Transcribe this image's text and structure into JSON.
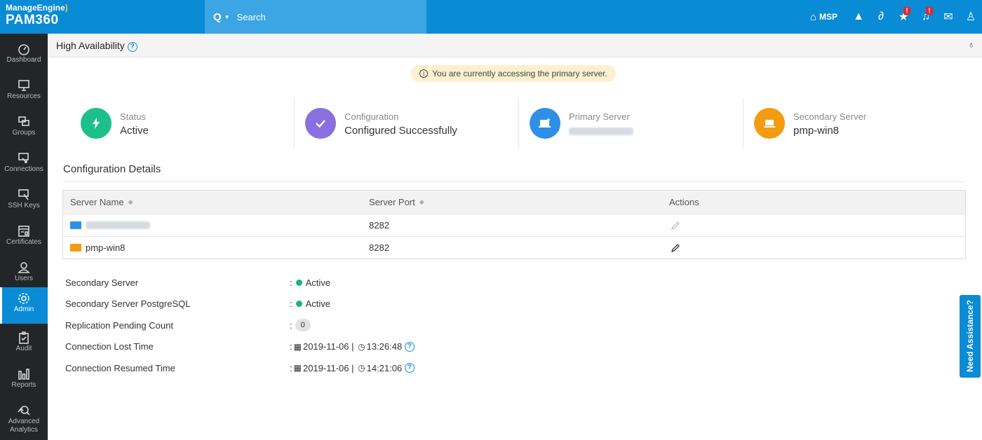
{
  "brand": {
    "company": "ManageEngine",
    "product": "PAM360"
  },
  "search": {
    "placeholder": "Search"
  },
  "topbar": {
    "msp_label": "MSP"
  },
  "sidebar": {
    "items": [
      {
        "label": "Dashboard"
      },
      {
        "label": "Resources"
      },
      {
        "label": "Groups"
      },
      {
        "label": "Connections"
      },
      {
        "label": "SSH Keys"
      },
      {
        "label": "Certificates"
      },
      {
        "label": "Users"
      },
      {
        "label": "Admin"
      },
      {
        "label": "Audit"
      },
      {
        "label": "Reports"
      },
      {
        "label": "Advanced Analytics"
      }
    ],
    "active": "Admin"
  },
  "page": {
    "title": "High Availability",
    "notice": "You are currently accessing the primary server."
  },
  "cards": [
    {
      "label": "Status",
      "value": "Active"
    },
    {
      "label": "Configuration",
      "value": "Configured Successfully"
    },
    {
      "label": "Primary Server",
      "value": ""
    },
    {
      "label": "Secondary Server",
      "value": "pmp-win8"
    }
  ],
  "config_details": {
    "title": "Configuration Details",
    "columns": [
      "Server Name",
      "Server Port",
      "Actions"
    ],
    "rows": [
      {
        "server_name": "",
        "server_port": "8282"
      },
      {
        "server_name": "pmp-win8",
        "server_port": "8282"
      }
    ]
  },
  "details": [
    {
      "label": "Secondary Server",
      "value": "Active"
    },
    {
      "label": "Secondary Server PostgreSQL",
      "value": "Active"
    },
    {
      "label": "Replication Pending Count",
      "value": "0"
    },
    {
      "label": "Connection Lost Time",
      "date": "2019-11-06",
      "time": "13:26:48"
    },
    {
      "label": "Connection Resumed Time",
      "date": "2019-11-06",
      "time": "14:21:06"
    }
  ],
  "assist": {
    "label": "Need Assistance?"
  },
  "colors": {
    "brand_blue": "#0a8bd6",
    "sidebar_bg": "#222629",
    "status_green": "#18b37a",
    "config_purple": "#8a6fe0",
    "primary_blue": "#2f8fe6",
    "secondary_orange": "#f39c12"
  },
  "icons": {
    "topbar": [
      "home-icon",
      "rocket-icon",
      "link-icon",
      "alert-icon",
      "bell-icon",
      "mail-icon",
      "user-icon"
    ],
    "cards": [
      "lightning-icon",
      "check-icon",
      "server-icon",
      "laptop-icon"
    ]
  }
}
